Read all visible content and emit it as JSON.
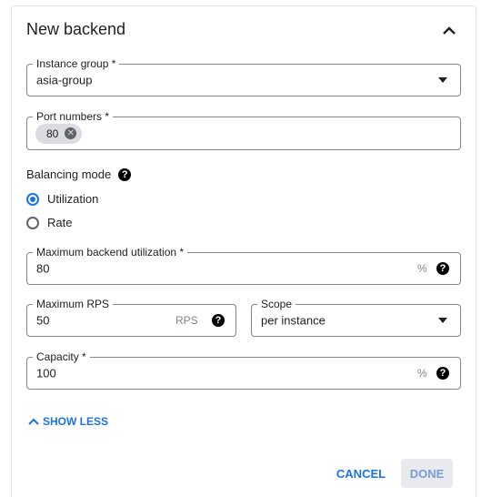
{
  "panel": {
    "title": "New backend"
  },
  "instance_group": {
    "label": "Instance group *",
    "value": "asia-group"
  },
  "port_numbers": {
    "label": "Port numbers *",
    "chips": [
      "80"
    ]
  },
  "balancing_mode": {
    "label": "Balancing mode",
    "options": [
      {
        "label": "Utilization",
        "selected": true
      },
      {
        "label": "Rate",
        "selected": false
      }
    ]
  },
  "max_backend_utilization": {
    "label": "Maximum backend utilization *",
    "value": "80",
    "unit": "%"
  },
  "max_rps": {
    "label": "Maximum RPS",
    "value": "50",
    "unit": "RPS"
  },
  "scope": {
    "label": "Scope",
    "value": "per instance"
  },
  "capacity": {
    "label": "Capacity *",
    "value": "100",
    "unit": "%"
  },
  "show_less": {
    "label": "SHOW LESS"
  },
  "actions": {
    "cancel": "CANCEL",
    "done": "DONE"
  },
  "colors": {
    "accent": "#1a73e8",
    "border": "#80868b",
    "done_bg": "#e8eaed"
  },
  "icons": {
    "collapse": "chevron-up-icon",
    "help": "help-icon",
    "dropdown": "dropdown-caret-icon",
    "chip_remove": "remove-chip-icon"
  }
}
